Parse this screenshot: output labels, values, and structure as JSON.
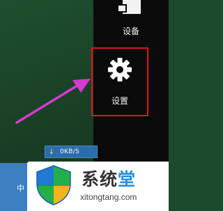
{
  "charms": {
    "devices": {
      "label": "设备",
      "icon": "devices-icon"
    },
    "settings": {
      "label": "设置",
      "icon": "gear-icon"
    }
  },
  "colors": {
    "highlight": "#e0141e",
    "arrow": "#d63ad0",
    "charm_bar": "#0b0b0b",
    "taskbar": "#3b7fc0"
  },
  "tray": {
    "net_speed": "0KB/S",
    "net_icon": "download-arrow-icon",
    "input_method": "中"
  },
  "watermark": {
    "title_prefix": "系统",
    "title_accent": "堂",
    "url": "xitongtang.com"
  }
}
